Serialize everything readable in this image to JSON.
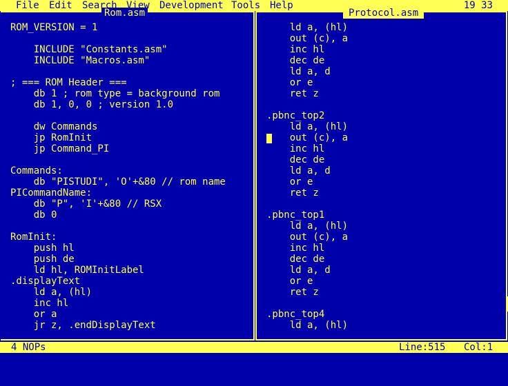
{
  "menu": {
    "file": "File",
    "edit": "Edit",
    "search": "Search",
    "view": "View",
    "development": "Development",
    "tools": "Tools",
    "help": "Help",
    "clock": "19 33"
  },
  "left_pane": {
    "title": "Rom.asm",
    "lines": [
      "ROM_VERSION = 1",
      "",
      "    INCLUDE \"Constants.asm\"",
      "    INCLUDE \"Macros.asm\"",
      "",
      "; === ROM Header ===",
      "    db 1 ; rom type = background rom",
      "    db 1, 0, 0 ; version 1.0",
      "",
      "    dw Commands",
      "    jp RomInit",
      "    jp Command_PI",
      "",
      "Commands:",
      "    db \"PISTUDI\", 'O'+&80 // rom name",
      "PICommandName:",
      "    db \"P\", 'I'+&80 // RSX",
      "    db 0",
      "",
      "RomInit:",
      "    push hl",
      "    push de",
      "    ld hl, ROMInitLabel",
      ".displayText",
      "    ld a, (hl)",
      "    inc hl",
      "    or a",
      "    jr z, .endDisplayText"
    ]
  },
  "right_pane": {
    "title": "Protocol.asm",
    "lines": [
      "    ld a, (hl)",
      "    out (c), a",
      "    inc hl",
      "    dec de",
      "    ld a, d",
      "    or e",
      "    ret z",
      "",
      ".pbnc_top2",
      "    ld a, (hl)",
      "    out (c), a",
      "    inc hl",
      "    dec de",
      "    ld a, d",
      "    or e",
      "    ret z",
      "",
      ".pbnc_top1",
      "    ld a, (hl)",
      "    out (c), a",
      "    inc hl",
      "    dec de",
      "    ld a, d",
      "    or e",
      "    ret z",
      "",
      ".pbnc_top4",
      "    ld a, (hl)"
    ]
  },
  "status": {
    "message": "4 NOPs",
    "line": "Line:515",
    "col": "Col:1"
  },
  "colors": {
    "background": "#0000aa",
    "foreground": "#ffff55"
  }
}
